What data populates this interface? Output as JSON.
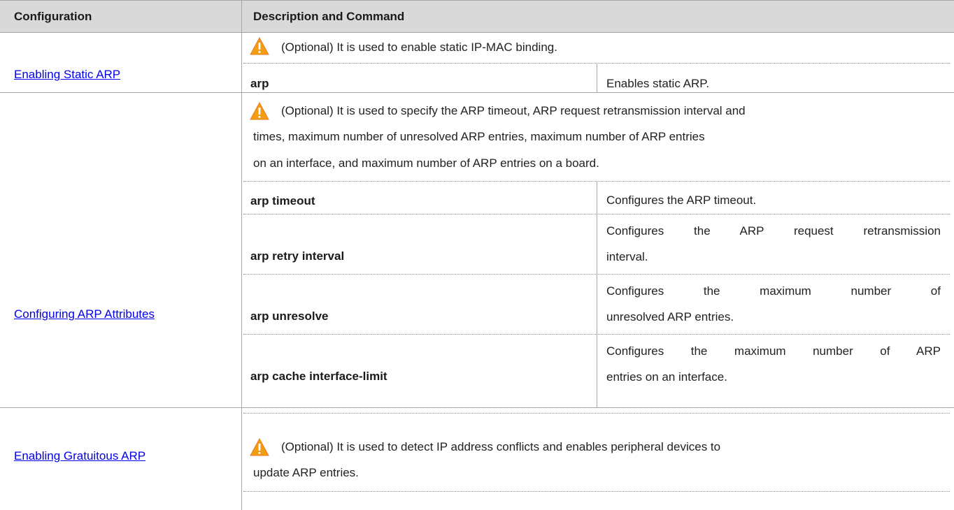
{
  "header": {
    "col1": "Configuration",
    "col2": "Description and Command"
  },
  "sections": [
    {
      "link": "Enabling Static ARP",
      "note": "(Optional) It is used to enable static IP-MAC binding.",
      "commands": [
        {
          "cmd": "arp",
          "desc": "Enables static ARP."
        }
      ]
    },
    {
      "link": "Configuring ARP Attributes",
      "note_lines": [
        "(Optional) It is used to specify the ARP timeout, ARP request retransmission interval and",
        "times, maximum number of unresolved ARP entries, maximum number of ARP entries",
        "on an interface, and maximum number of ARP entries on a board."
      ],
      "commands": [
        {
          "cmd": "arp timeout",
          "desc": "Configures the ARP timeout."
        },
        {
          "cmd": "arp retry interval",
          "desc_lines": [
            "Configures the ARP request retransmission",
            "interval."
          ]
        },
        {
          "cmd": "arp unresolve",
          "desc_lines": [
            "Configures the maximum number of",
            "unresolved ARP entries."
          ]
        },
        {
          "cmd": "arp cache interface-limit",
          "desc_lines": [
            "Configures the maximum number of ARP",
            "entries on an interface."
          ]
        }
      ]
    },
    {
      "link": "Enabling Gratuitous ARP",
      "note_lines": [
        "(Optional) It is used to detect IP address conflicts and enables peripheral devices to",
        "update ARP entries."
      ]
    }
  ],
  "colors": {
    "header_bg": "#d9d9d9",
    "link": "#0000ee",
    "warning_fill": "#f39c12"
  },
  "icons": {
    "warning": "warning-icon"
  }
}
